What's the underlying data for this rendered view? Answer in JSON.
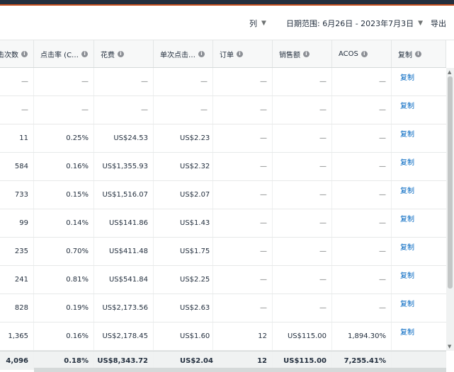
{
  "toolbar": {
    "columns_label": "列",
    "date_range_label": "日期范围: 6月26日 - 2023年7月3日",
    "export_label": "导出"
  },
  "header": {
    "clicks": "点击次数",
    "ctr": "点击率 (C…",
    "spend": "花费",
    "cpc": "单次点击…",
    "orders": "订单",
    "sales": "销售额",
    "acos": "ACOS",
    "copy": "复制"
  },
  "rows": [
    {
      "clicks": "—",
      "ctr": "—",
      "spend": "—",
      "cpc": "—",
      "orders": "—",
      "sales": "—",
      "acos": "—",
      "copy": "复制"
    },
    {
      "clicks": "—",
      "ctr": "—",
      "spend": "—",
      "cpc": "—",
      "orders": "—",
      "sales": "—",
      "acos": "—",
      "copy": "复制"
    },
    {
      "clicks": "11",
      "ctr": "0.25%",
      "spend": "US$24.53",
      "cpc": "US$2.23",
      "orders": "—",
      "sales": "—",
      "acos": "—",
      "copy": "复制"
    },
    {
      "clicks": "584",
      "ctr": "0.16%",
      "spend": "US$1,355.93",
      "cpc": "US$2.32",
      "orders": "—",
      "sales": "—",
      "acos": "—",
      "copy": "复制"
    },
    {
      "clicks": "733",
      "ctr": "0.15%",
      "spend": "US$1,516.07",
      "cpc": "US$2.07",
      "orders": "—",
      "sales": "—",
      "acos": "—",
      "copy": "复制"
    },
    {
      "clicks": "99",
      "ctr": "0.14%",
      "spend": "US$141.86",
      "cpc": "US$1.43",
      "orders": "—",
      "sales": "—",
      "acos": "—",
      "copy": "复制"
    },
    {
      "clicks": "235",
      "ctr": "0.70%",
      "spend": "US$411.48",
      "cpc": "US$1.75",
      "orders": "—",
      "sales": "—",
      "acos": "—",
      "copy": "复制"
    },
    {
      "clicks": "241",
      "ctr": "0.81%",
      "spend": "US$541.84",
      "cpc": "US$2.25",
      "orders": "—",
      "sales": "—",
      "acos": "—",
      "copy": "复制"
    },
    {
      "clicks": "828",
      "ctr": "0.19%",
      "spend": "US$2,173.56",
      "cpc": "US$2.63",
      "orders": "—",
      "sales": "—",
      "acos": "—",
      "copy": "复制"
    },
    {
      "clicks": "1,365",
      "ctr": "0.16%",
      "spend": "US$2,178.45",
      "cpc": "US$1.60",
      "orders": "12",
      "sales": "US$115.00",
      "acos": "1,894.30%",
      "copy": "复制"
    }
  ],
  "totals": {
    "clicks": "4,096",
    "ctr": "0.18%",
    "spend": "US$8,343.72",
    "cpc": "US$2.04",
    "orders": "12",
    "sales": "US$115.00",
    "acos": "7,255.41%"
  },
  "icons": {
    "info": "info-icon",
    "chevron": "chevron-down-icon"
  }
}
